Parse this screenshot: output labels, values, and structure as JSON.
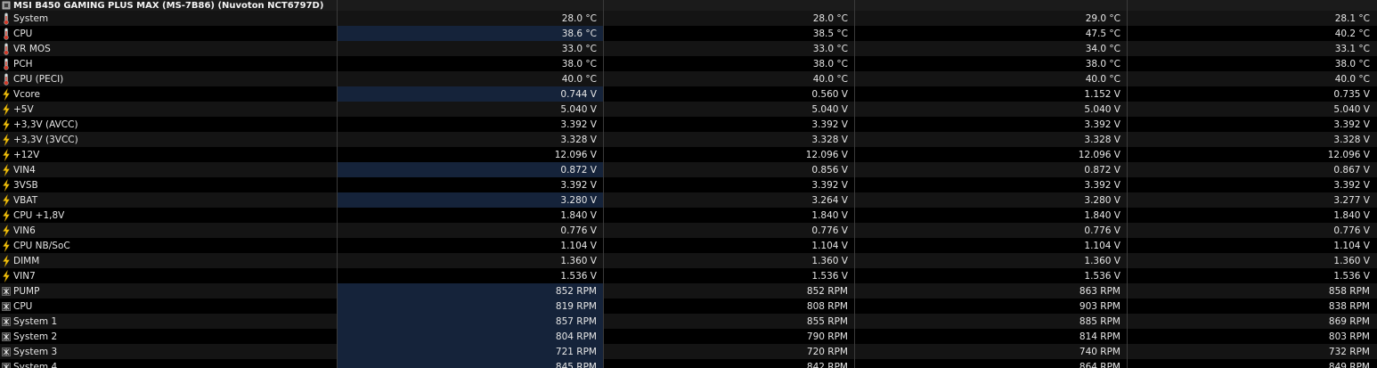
{
  "device_header": {
    "title": "MSI B450 GAMING PLUS MAX (MS-7B86) (Nuvoton NCT6797D)",
    "icon": "chip-icon"
  },
  "rows": [
    {
      "label": "System",
      "icon": "thermometer-icon",
      "values": [
        "28.0 °C",
        "28.0 °C",
        "29.0 °C",
        "28.1 °C"
      ],
      "highlight": false
    },
    {
      "label": "CPU",
      "icon": "thermometer-icon",
      "values": [
        "38.6 °C",
        "38.5 °C",
        "47.5 °C",
        "40.2 °C"
      ],
      "highlight": true
    },
    {
      "label": "VR MOS",
      "icon": "thermometer-icon",
      "values": [
        "33.0 °C",
        "33.0 °C",
        "34.0 °C",
        "33.1 °C"
      ],
      "highlight": false
    },
    {
      "label": "PCH",
      "icon": "thermometer-icon",
      "values": [
        "38.0 °C",
        "38.0 °C",
        "38.0 °C",
        "38.0 °C"
      ],
      "highlight": false
    },
    {
      "label": "CPU (PECI)",
      "icon": "thermometer-icon",
      "values": [
        "40.0 °C",
        "40.0 °C",
        "40.0 °C",
        "40.0 °C"
      ],
      "highlight": false
    },
    {
      "label": "Vcore",
      "icon": "lightning-icon",
      "values": [
        "0.744 V",
        "0.560 V",
        "1.152 V",
        "0.735 V"
      ],
      "highlight": true
    },
    {
      "label": "+5V",
      "icon": "lightning-icon",
      "values": [
        "5.040 V",
        "5.040 V",
        "5.040 V",
        "5.040 V"
      ],
      "highlight": false
    },
    {
      "label": "+3,3V (AVCC)",
      "icon": "lightning-icon",
      "values": [
        "3.392 V",
        "3.392 V",
        "3.392 V",
        "3.392 V"
      ],
      "highlight": false
    },
    {
      "label": "+3,3V (3VCC)",
      "icon": "lightning-icon",
      "values": [
        "3.328 V",
        "3.328 V",
        "3.328 V",
        "3.328 V"
      ],
      "highlight": false
    },
    {
      "label": "+12V",
      "icon": "lightning-icon",
      "values": [
        "12.096 V",
        "12.096 V",
        "12.096 V",
        "12.096 V"
      ],
      "highlight": false
    },
    {
      "label": "VIN4",
      "icon": "lightning-icon",
      "values": [
        "0.872 V",
        "0.856 V",
        "0.872 V",
        "0.867 V"
      ],
      "highlight": true
    },
    {
      "label": "3VSB",
      "icon": "lightning-icon",
      "values": [
        "3.392 V",
        "3.392 V",
        "3.392 V",
        "3.392 V"
      ],
      "highlight": false
    },
    {
      "label": "VBAT",
      "icon": "lightning-icon",
      "values": [
        "3.280 V",
        "3.264 V",
        "3.280 V",
        "3.277 V"
      ],
      "highlight": true
    },
    {
      "label": "CPU +1,8V",
      "icon": "lightning-icon",
      "values": [
        "1.840 V",
        "1.840 V",
        "1.840 V",
        "1.840 V"
      ],
      "highlight": false
    },
    {
      "label": "VIN6",
      "icon": "lightning-icon",
      "values": [
        "0.776 V",
        "0.776 V",
        "0.776 V",
        "0.776 V"
      ],
      "highlight": false
    },
    {
      "label": "CPU NB/SoC",
      "icon": "lightning-icon",
      "values": [
        "1.104 V",
        "1.104 V",
        "1.104 V",
        "1.104 V"
      ],
      "highlight": false
    },
    {
      "label": "DIMM",
      "icon": "lightning-icon",
      "values": [
        "1.360 V",
        "1.360 V",
        "1.360 V",
        "1.360 V"
      ],
      "highlight": false
    },
    {
      "label": "VIN7",
      "icon": "lightning-icon",
      "values": [
        "1.536 V",
        "1.536 V",
        "1.536 V",
        "1.536 V"
      ],
      "highlight": false
    },
    {
      "label": "PUMP",
      "icon": "fan-icon",
      "values": [
        "852 RPM",
        "852 RPM",
        "863 RPM",
        "858 RPM"
      ],
      "highlight": true
    },
    {
      "label": "CPU",
      "icon": "fan-icon",
      "values": [
        "819 RPM",
        "808 RPM",
        "903 RPM",
        "838 RPM"
      ],
      "highlight": true
    },
    {
      "label": "System 1",
      "icon": "fan-icon",
      "values": [
        "857 RPM",
        "855 RPM",
        "885 RPM",
        "869 RPM"
      ],
      "highlight": true
    },
    {
      "label": "System 2",
      "icon": "fan-icon",
      "values": [
        "804 RPM",
        "790 RPM",
        "814 RPM",
        "803 RPM"
      ],
      "highlight": true
    },
    {
      "label": "System 3",
      "icon": "fan-icon",
      "values": [
        "721 RPM",
        "720 RPM",
        "740 RPM",
        "732 RPM"
      ],
      "highlight": true
    },
    {
      "label": "System 4",
      "icon": "fan-icon",
      "values": [
        "845 RPM",
        "842 RPM",
        "864 RPM",
        "849 RPM"
      ],
      "highlight": true
    }
  ],
  "colors": {
    "background": "#000000",
    "row_alt": "#141414",
    "grid": "#3a3a3a",
    "highlight_cell": "#15233a",
    "text": "#e6e6e6"
  }
}
